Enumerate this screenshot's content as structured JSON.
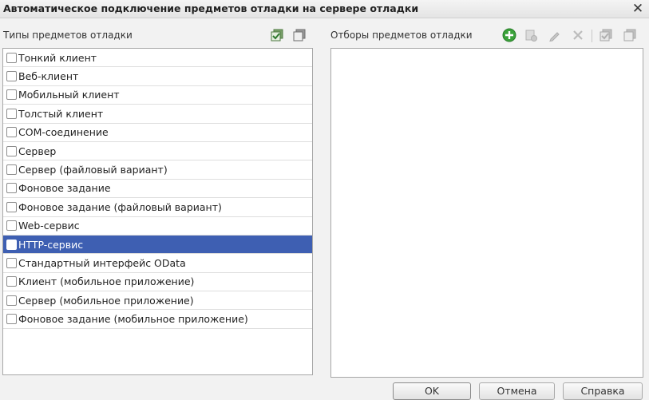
{
  "window": {
    "title": "Автоматическое подключение предметов отладки на сервере отладки",
    "close_glyph": "✕"
  },
  "left_panel": {
    "label": "Типы предметов отладки",
    "toolbar_icons": [
      "check-all-icon",
      "uncheck-all-icon"
    ],
    "items": [
      {
        "label": "Тонкий клиент",
        "checked": false,
        "selected": false
      },
      {
        "label": "Веб-клиент",
        "checked": false,
        "selected": false
      },
      {
        "label": "Мобильный клиент",
        "checked": false,
        "selected": false
      },
      {
        "label": "Толстый клиент",
        "checked": false,
        "selected": false
      },
      {
        "label": "COM-соединение",
        "checked": false,
        "selected": false
      },
      {
        "label": "Сервер",
        "checked": false,
        "selected": false
      },
      {
        "label": "Сервер (файловый вариант)",
        "checked": false,
        "selected": false
      },
      {
        "label": "Фоновое задание",
        "checked": false,
        "selected": false
      },
      {
        "label": "Фоновое задание (файловый вариант)",
        "checked": false,
        "selected": false
      },
      {
        "label": "Web-сервис",
        "checked": false,
        "selected": false
      },
      {
        "label": "HTTP-сервис",
        "checked": false,
        "selected": true
      },
      {
        "label": "Стандартный интерфейс OData",
        "checked": false,
        "selected": false
      },
      {
        "label": "Клиент (мобильное приложение)",
        "checked": false,
        "selected": false
      },
      {
        "label": "Сервер (мобильное приложение)",
        "checked": false,
        "selected": false
      },
      {
        "label": "Фоновое задание (мобильное приложение)",
        "checked": false,
        "selected": false
      }
    ]
  },
  "right_panel": {
    "label": "Отборы предметов отладки",
    "toolbar_icons": [
      "add-icon",
      "copy-icon",
      "edit-icon",
      "delete-icon",
      "check-all-icon",
      "uncheck-all-icon"
    ]
  },
  "buttons": {
    "ok": "OK",
    "cancel": "Отмена",
    "help": "Справка"
  },
  "colors": {
    "selection": "#3e5fb2",
    "add_icon": "#3aa23a"
  }
}
